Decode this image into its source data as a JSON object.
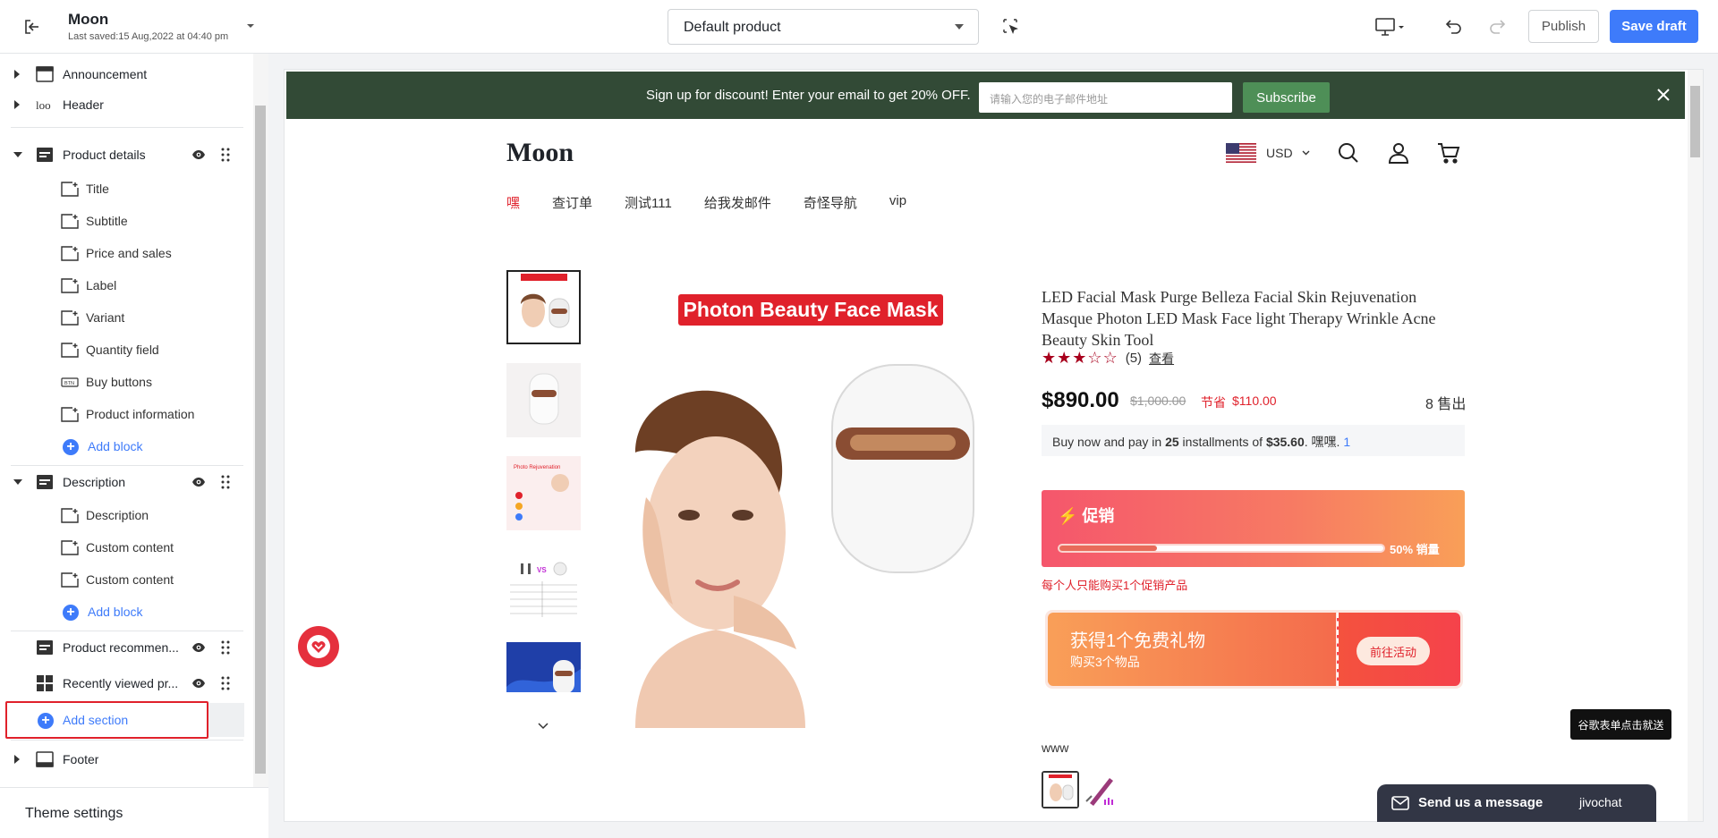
{
  "topbar": {
    "store_name": "Moon",
    "last_saved": "Last saved:15 Aug,2022 at 04:40 pm",
    "product_select": "Default product",
    "publish_label": "Publish",
    "save_label": "Save draft"
  },
  "sidebar": {
    "sections": [
      {
        "label": "Announcement"
      },
      {
        "label": "Header"
      },
      {
        "label": "Product details"
      },
      {
        "label": "Description"
      },
      {
        "label": "Product recommen..."
      },
      {
        "label": "Recently viewed pr..."
      },
      {
        "label": "Footer"
      }
    ],
    "product_blocks": [
      "Title",
      "Subtitle",
      "Price and sales",
      "Label",
      "Variant",
      "Quantity field",
      "Buy buttons",
      "Product information"
    ],
    "description_blocks": [
      "Description",
      "Custom content",
      "Custom content"
    ],
    "add_block_label": "Add block",
    "add_section_label": "Add section",
    "theme_settings_label": "Theme settings"
  },
  "preview": {
    "announcement": {
      "message": "Sign up for discount! Enter your email to get 20% OFF.",
      "email_placeholder": "请输入您的电子邮件地址",
      "subscribe_label": "Subscribe"
    },
    "brand": "Moon",
    "currency": "USD",
    "nav": [
      "嘿",
      "查订单",
      "测试111",
      "给我发邮件",
      "奇怪导航",
      "vip"
    ],
    "main_image_banner": "Photon Beauty Face Mask",
    "product_title": "LED Facial Mask Purge Belleza Facial Skin Rejuvenation Masque Photon LED Mask Face light Therapy Wrinkle Acne Beauty Skin Tool",
    "rating_stars": 3,
    "rating_count": "(5)",
    "rating_view": "查看",
    "price": "$890.00",
    "compare_price": "$1,000.00",
    "save_label": "节省",
    "save_amount": "$110.00",
    "sold": "8 售出",
    "installments": {
      "pre": "Buy now and pay in ",
      "count": "25",
      "mid": " installments of ",
      "amount": "$35.60",
      "post": ". 嘿嘿. ",
      "link": "1"
    },
    "promo": {
      "title": "⚡ 促销",
      "progress": 0.3,
      "percent_label": "50% 销量",
      "note": "每个人只能购买1个促销产品"
    },
    "gift": {
      "title": "获得1个免费礼物",
      "subtitle": "购买3个物品",
      "button": "前往活动"
    },
    "variant_label": "www",
    "tooltip": "谷歌表单点击就送",
    "chat": {
      "message": "Send us a message",
      "brand": "jivochat"
    }
  },
  "colors": {
    "accent": "#3e7bfa",
    "announcement_bg": "#324a36",
    "subscribe_bg": "#4e8f57",
    "sale_red": "#e0212b",
    "highlight_border": "#e0212b"
  }
}
